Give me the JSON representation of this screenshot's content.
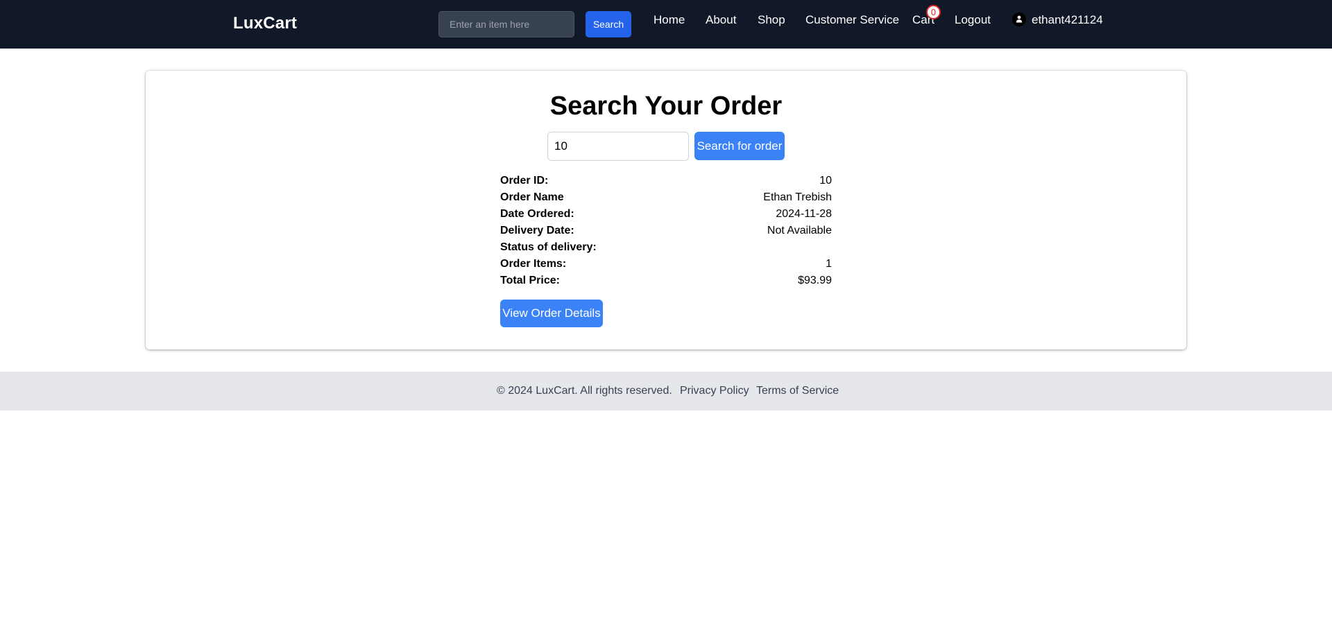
{
  "header": {
    "brand": "LuxCart",
    "search": {
      "placeholder": "Enter an item here",
      "value": "",
      "button_label": "Search"
    },
    "nav": {
      "home": "Home",
      "about": "About",
      "shop": "Shop",
      "customer_service": "Customer Service",
      "cart": "Cart",
      "cart_count": "0",
      "logout": "Logout",
      "username": "ethant421124"
    }
  },
  "main": {
    "title": "Search Your Order",
    "order_search": {
      "value": "10",
      "button_label": "Search for order"
    },
    "details": [
      {
        "label": "Order ID:",
        "value": "10"
      },
      {
        "label": "Order Name",
        "value": "Ethan Trebish"
      },
      {
        "label": "Date Ordered:",
        "value": "2024-11-28"
      },
      {
        "label": "Delivery Date:",
        "value": "Not Available"
      },
      {
        "label": "Status of delivery:",
        "value": ""
      },
      {
        "label": "Order Items:",
        "value": "1"
      },
      {
        "label": "Total Price:",
        "value": "$93.99"
      }
    ],
    "view_details_label": "View Order Details"
  },
  "footer": {
    "copyright": "© 2024 LuxCart. All rights reserved.",
    "privacy": "Privacy Policy",
    "terms": "Terms of Service"
  },
  "icons": {
    "user": "user-icon"
  },
  "colors": {
    "nav_bg": "#111827",
    "primary": "#3b82f6",
    "nav_button": "#2563eb",
    "badge": "#dc2626",
    "footer_bg": "#e5e7eb"
  }
}
